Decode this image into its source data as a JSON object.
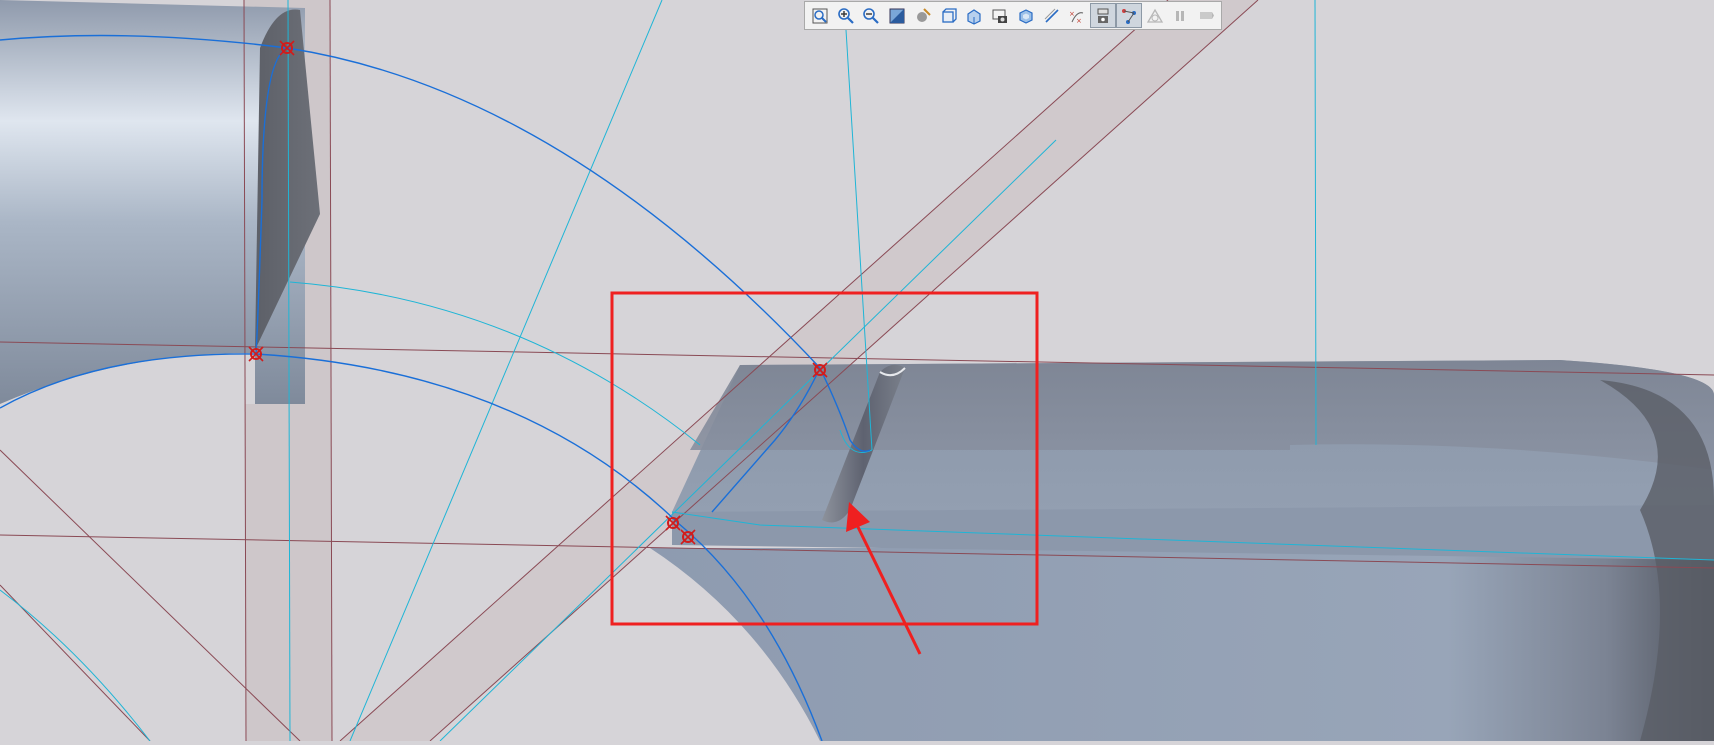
{
  "app": {
    "type": "cad-3d-viewport"
  },
  "colors": {
    "background": "#d6d4d8",
    "sketch_curve": "#1a6fd8",
    "construction_line": "#1fb5d6",
    "datum_line": "#8a4a55",
    "datum_plane": "#cdc6c9",
    "part_light": "#9aa8bb",
    "part_dark": "#5f646d",
    "highlight_box": "#ef2020",
    "arrow": "#ef2020",
    "point_marker": "#d11c1c"
  },
  "toolbar": {
    "buttons": [
      {
        "id": "zoom-fit",
        "icon": "zoom-fit-icon",
        "active": false,
        "disabled": false
      },
      {
        "id": "zoom-in",
        "icon": "zoom-in-icon",
        "active": false,
        "disabled": false
      },
      {
        "id": "zoom-out",
        "icon": "zoom-out-icon",
        "active": false,
        "disabled": false
      },
      {
        "id": "section",
        "icon": "section-view-icon",
        "active": false,
        "disabled": false
      },
      {
        "id": "render",
        "icon": "render-style-icon",
        "active": false,
        "disabled": false
      },
      {
        "id": "display-style",
        "icon": "display-style-icon",
        "active": false,
        "disabled": false
      },
      {
        "id": "view-orient",
        "icon": "view-orientation-icon",
        "active": false,
        "disabled": false
      },
      {
        "id": "screenshot",
        "icon": "camera-icon",
        "active": false,
        "disabled": false
      },
      {
        "id": "appearance",
        "icon": "appearance-icon",
        "active": false,
        "disabled": false
      },
      {
        "id": "datum-plane",
        "icon": "datum-plane-icon",
        "active": false,
        "disabled": false
      },
      {
        "id": "datum-point",
        "icon": "datum-point-icon",
        "active": false,
        "disabled": false
      },
      {
        "id": "show-dims",
        "icon": "show-dimensions-icon",
        "active": true,
        "disabled": false
      },
      {
        "id": "show-constraints",
        "icon": "constraints-icon",
        "active": true,
        "disabled": false
      },
      {
        "id": "tangent",
        "icon": "tangent-icon",
        "active": false,
        "disabled": true
      },
      {
        "id": "pause",
        "icon": "pause-icon",
        "active": false,
        "disabled": true
      },
      {
        "id": "flag",
        "icon": "flag-icon",
        "active": false,
        "disabled": true
      }
    ]
  }
}
